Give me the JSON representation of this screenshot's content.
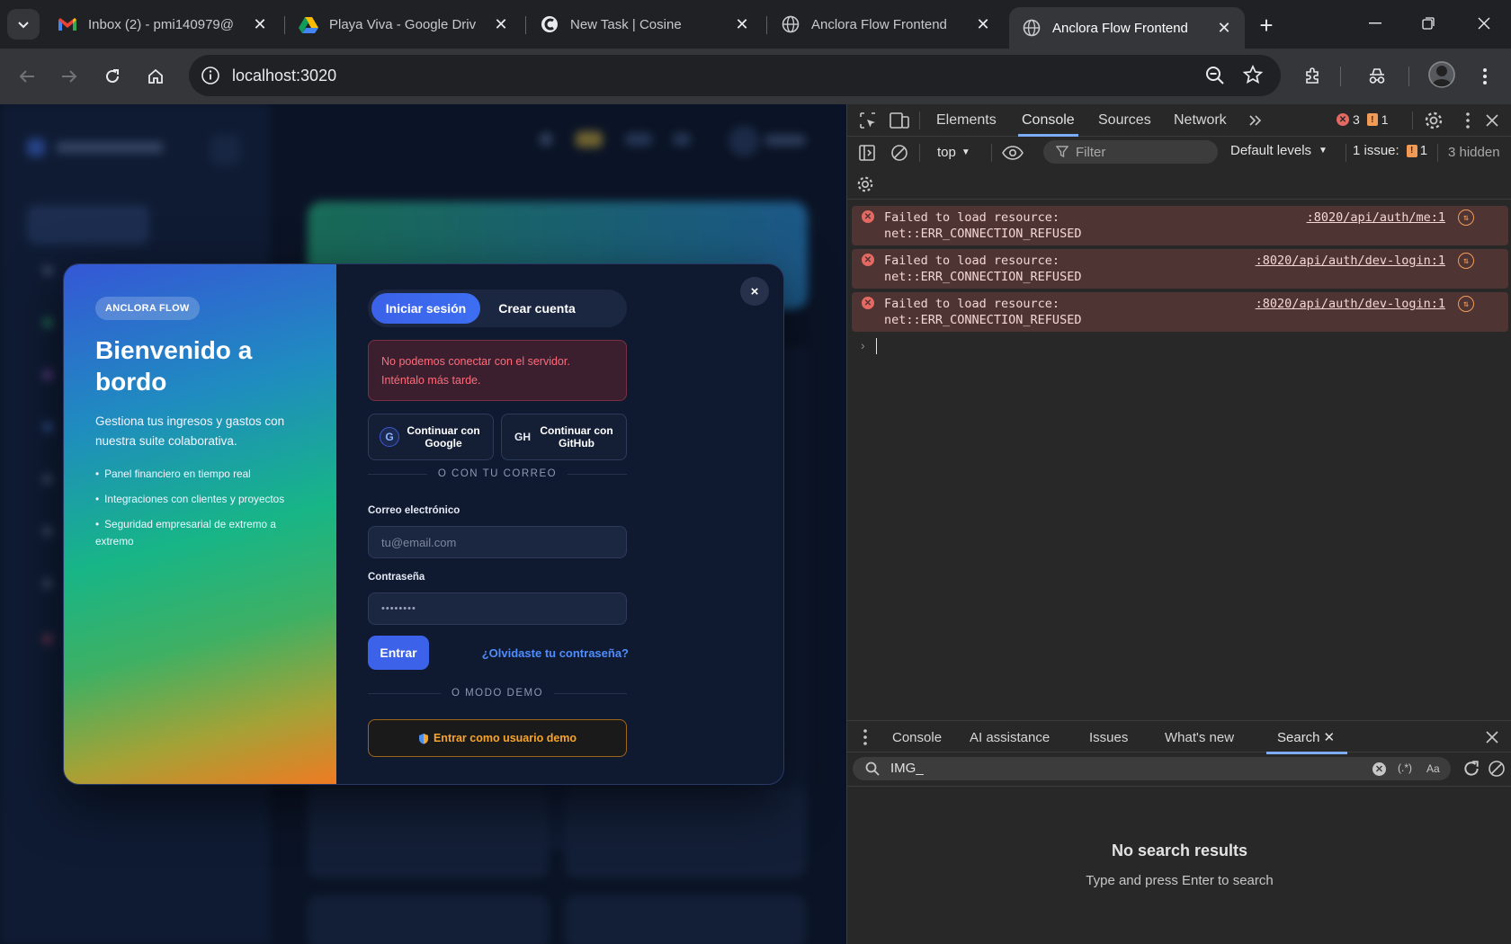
{
  "browser": {
    "tabs": [
      {
        "title": "Inbox (2) - pmi140979@",
        "icon": "gmail-icon"
      },
      {
        "title": "Playa Viva - Google Driv",
        "icon": "google-drive-icon"
      },
      {
        "title": "New Task | Cosine",
        "icon": "cosine-icon"
      },
      {
        "title": "Anclora Flow Frontend",
        "icon": "globe-icon"
      },
      {
        "title": "Anclora Flow Frontend",
        "icon": "globe-icon",
        "active": true
      }
    ],
    "url": "localhost:3020"
  },
  "modal": {
    "brand": "ANCLORA FLOW",
    "title": "Bienvenido a bordo",
    "description": "Gestiona tus ingresos y gastos con nuestra suite colaborativa.",
    "features": [
      "Panel financiero en tiempo real",
      "Integraciones con clientes y proyectos",
      "Seguridad empresarial de extremo a extremo"
    ],
    "tabs": {
      "login": "Iniciar sesión",
      "register": "Crear cuenta"
    },
    "error": "No podemos conectar con el servidor. Inténtalo más tarde.",
    "social": {
      "google": {
        "label": "Continuar con Google",
        "icon_text": "G"
      },
      "github": {
        "label": "Continuar con GitHub",
        "icon_text": "GH"
      }
    },
    "divider_email": "O CON TU CORREO",
    "email_label": "Correo electrónico",
    "email_placeholder": "tu@email.com",
    "password_label": "Contraseña",
    "password_value": "••••••••",
    "submit": "Entrar",
    "forgot": "¿Olvidaste tu contraseña?",
    "divider_demo": "O MODO DEMO",
    "demo_button": "Entrar como usuario demo",
    "close": "×"
  },
  "devtools": {
    "tabs": [
      "Elements",
      "Console",
      "Sources",
      "Network"
    ],
    "active_tab": "Console",
    "error_count": "3",
    "warning_count": "1",
    "context": "top",
    "filter_placeholder": "Filter",
    "levels": "Default levels",
    "issues_label": "1 issue:",
    "issues_count": "1",
    "hidden": "3 hidden",
    "messages": [
      {
        "text": "Failed to load resource:",
        "detail": "net::ERR_CONNECTION_REFUSED",
        "source": ":8020/api/auth/me:1"
      },
      {
        "text": "Failed to load resource:",
        "detail": "net::ERR_CONNECTION_REFUSED",
        "source": ":8020/api/auth/dev-login:1"
      },
      {
        "text": "Failed to load resource:",
        "detail": "net::ERR_CONNECTION_REFUSED",
        "source": ":8020/api/auth/dev-login:1"
      }
    ],
    "drawer_tabs": [
      "Console",
      "AI assistance",
      "Issues",
      "What's new",
      "Search"
    ],
    "drawer_active": "Search",
    "search_query": "IMG_",
    "search_regex": "(.*)",
    "search_case": "Aa",
    "no_results_title": "No search results",
    "no_results_hint": "Type and press Enter to search"
  },
  "colors": {
    "accent": "#3b62e8",
    "error": "#ff6b7a",
    "demo": "#f7a42b",
    "devtools_accent": "#7cacf8"
  }
}
